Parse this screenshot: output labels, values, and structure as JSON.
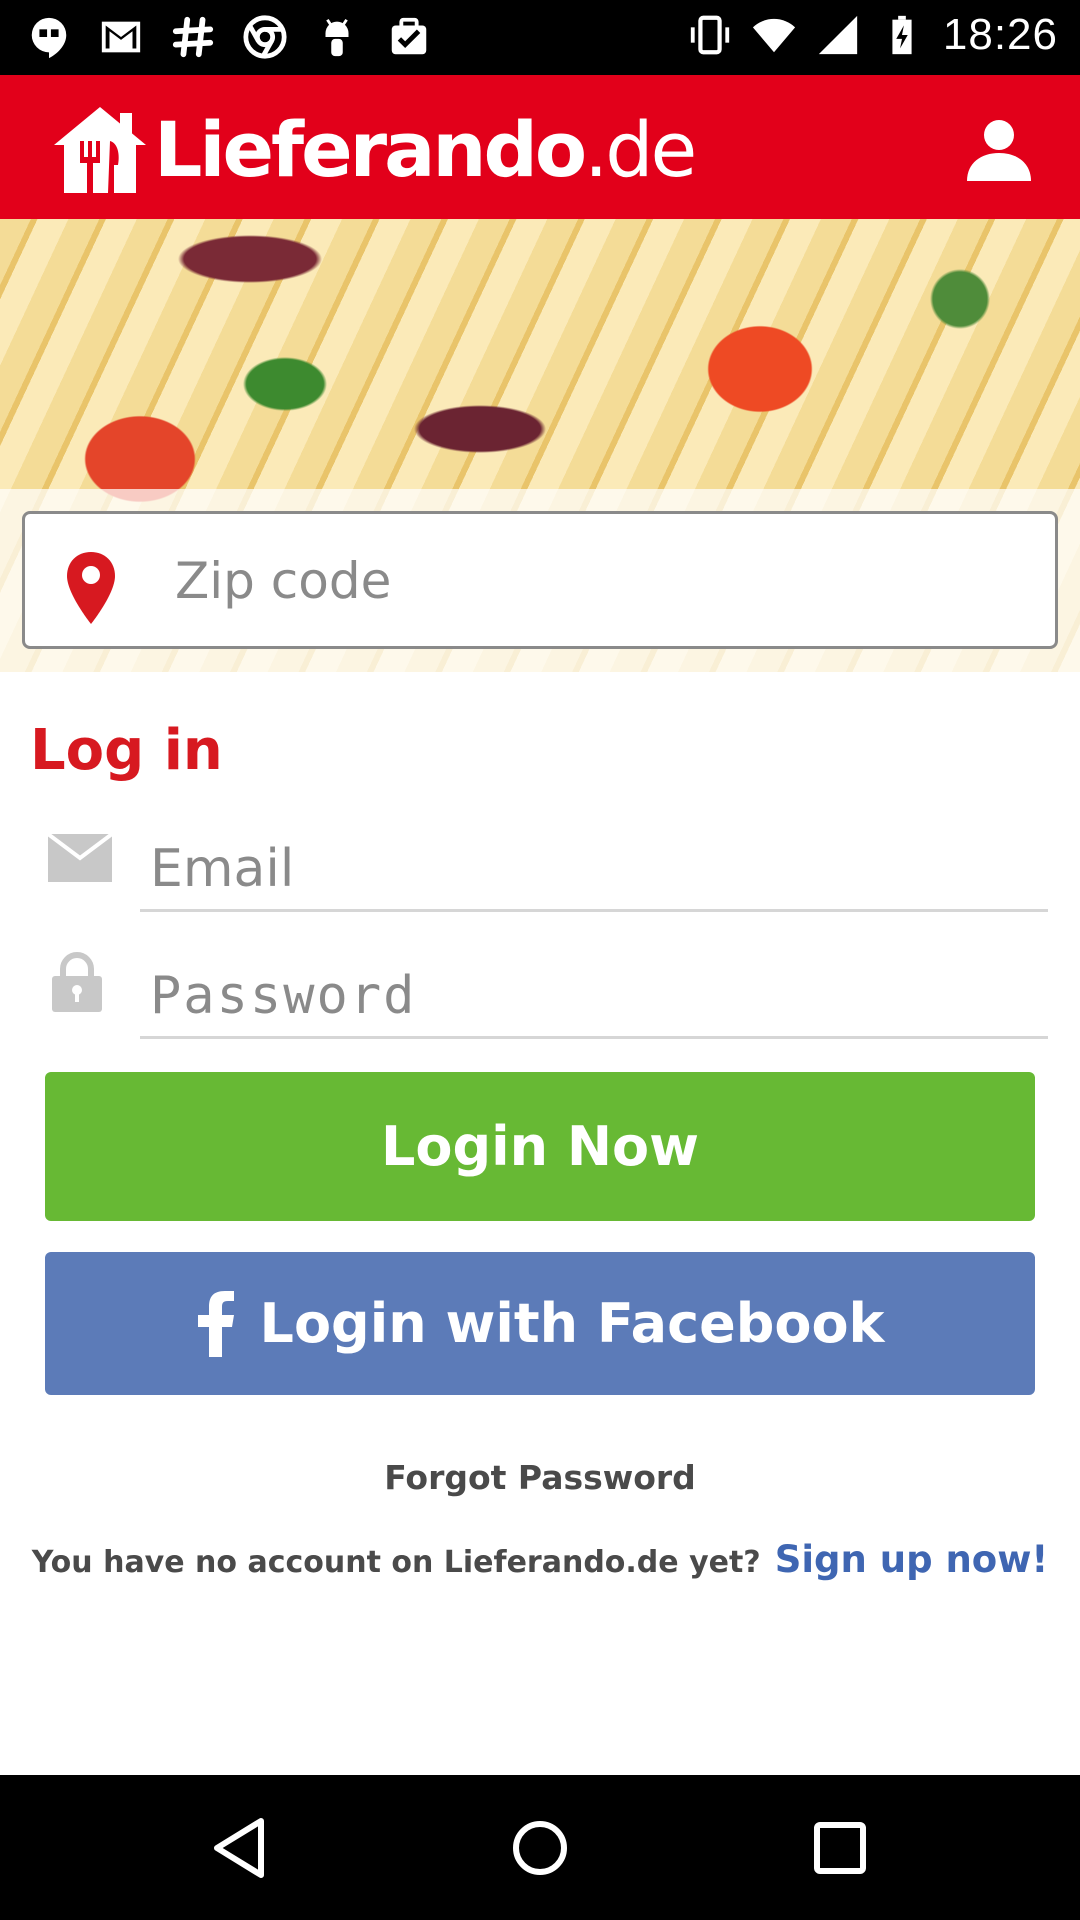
{
  "status_bar": {
    "time": "18:26",
    "left_icons": [
      "hangouts-icon",
      "gmail-icon",
      "slack-icon",
      "chrome-icon",
      "android-debug-icon",
      "clipboard-check-icon"
    ],
    "right_icons": [
      "vibrate-icon",
      "wifi-icon",
      "signal-icon",
      "battery-icon"
    ]
  },
  "header": {
    "brand": "Lieferando",
    "brand_tld": ".de",
    "account_icon": "user-icon",
    "color": "#e2001a"
  },
  "search": {
    "zip_placeholder": "Zip code",
    "pin_icon": "location-pin-icon"
  },
  "login": {
    "title": "Log in",
    "email_placeholder": "Email",
    "password_placeholder": "Password",
    "login_button": "Login Now",
    "facebook_button": "Login with Facebook",
    "forgot_password": "Forgot Password",
    "no_account_text": "You have no account on Lieferando.de yet?",
    "signup_link": "Sign up now!"
  },
  "colors": {
    "accent_red": "#d71920",
    "login_green": "#67b934",
    "facebook_blue": "#5c7bb8",
    "link_blue": "#3f66b2"
  },
  "nav_bar": {
    "icons": [
      "back-icon",
      "home-icon",
      "recents-icon"
    ]
  }
}
